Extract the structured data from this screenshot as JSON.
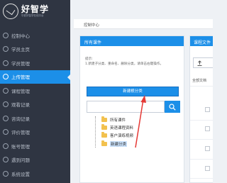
{
  "logo": {
    "title": "好智学",
    "subtitle": "华夏好智学在线平台"
  },
  "sidebar": {
    "items": [
      {
        "label": "控制中心"
      },
      {
        "label": "学员主页"
      },
      {
        "label": "学员管理"
      },
      {
        "label": "上传管理"
      },
      {
        "label": "课程管理"
      },
      {
        "label": "观看记录"
      },
      {
        "label": "咨询记录"
      },
      {
        "label": "评价管理"
      },
      {
        "label": "账号管理"
      },
      {
        "label": "遇到问题"
      },
      {
        "label": "系统设置"
      }
    ],
    "active_index": 3
  },
  "breadcrumb": {
    "label": "控制中心"
  },
  "panel": {
    "title": "所有课件",
    "tip_line1": "提示:",
    "tip_line2": "1.新建子分类、重命名、删除分类，请单击右键操作。",
    "add_button": "新建根分类",
    "search_placeholder": ""
  },
  "tree": {
    "items": [
      {
        "label": "所有课件"
      },
      {
        "label": "英语课程资料"
      },
      {
        "label": "客户演练视频"
      },
      {
        "label": "新建分类"
      }
    ]
  },
  "panel2": {
    "title": "课程文件",
    "all_docs": "全部文档"
  },
  "colors": {
    "accent": "#1c8fe8",
    "sidebar": "#2f3542",
    "arrow": "#e53935"
  }
}
